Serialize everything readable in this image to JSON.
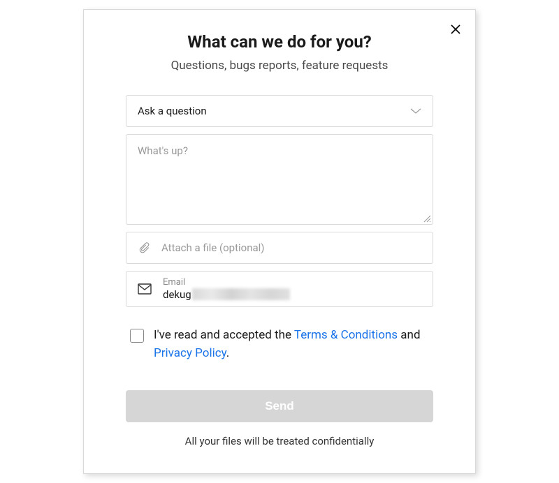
{
  "header": {
    "title": "What can we do for you?",
    "subtitle": "Questions, bugs reports, feature requests"
  },
  "form": {
    "topic_selected": "Ask a question",
    "message_placeholder": "What's up?",
    "attach_label": "Attach a file (optional)",
    "email_label": "Email",
    "email_value": "dekug"
  },
  "consent": {
    "prefix": "I've read and accepted the ",
    "terms_link": "Terms & Conditions",
    "middle": " and ",
    "privacy_link": "Privacy Policy",
    "suffix": "."
  },
  "actions": {
    "send_label": "Send"
  },
  "footer": {
    "note": "All your files will be treated confidentially"
  }
}
